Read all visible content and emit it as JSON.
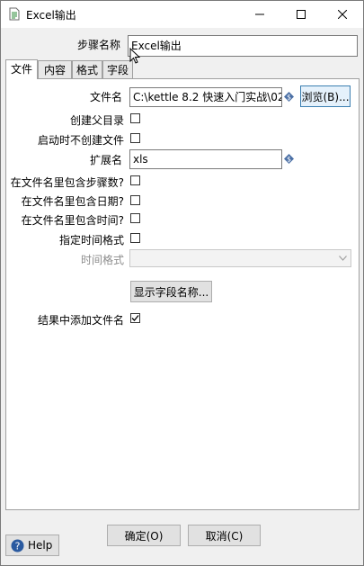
{
  "window": {
    "title": "Excel输出",
    "icon": "document-icon",
    "controls": [
      "minimize-icon",
      "maximize-icon",
      "close-icon"
    ]
  },
  "step_name": {
    "label": "步骤名称",
    "value": "Excel输出"
  },
  "tabs": [
    {
      "label": "文件",
      "active": true
    },
    {
      "label": "内容",
      "active": false
    },
    {
      "label": "格式",
      "active": false
    },
    {
      "label": "字段",
      "active": false
    }
  ],
  "file_tab": {
    "filename_label": "文件名",
    "filename_value": "C:\\kettle 8.2 快速入门实战\\02",
    "browse_label": "浏览(B)...",
    "create_parent_label": "创建父目录",
    "create_parent_checked": false,
    "no_create_on_start_label": "启动时不创建文件",
    "no_create_on_start_checked": false,
    "extension_label": "扩展名",
    "extension_value": "xls",
    "include_stepnr_label": "在文件名里包含步骤数?",
    "include_stepnr_checked": false,
    "include_date_label": "在文件名里包含日期?",
    "include_date_checked": false,
    "include_time_label": "在文件名里包含时间?",
    "include_time_checked": false,
    "specify_format_label": "指定时间格式",
    "specify_format_checked": false,
    "date_format_label": "时间格式",
    "date_format_value": "",
    "show_fields_label": "显示字段名称...",
    "add_to_result_label": "结果中添加文件名",
    "add_to_result_checked": true
  },
  "footer": {
    "ok_label": "确定(O)",
    "cancel_label": "取消(C)",
    "help_label": "Help"
  },
  "colors": {
    "variable_icon": "#4a6fa5",
    "dialog_bg": "#f0f0f0",
    "help_icon": "#2a5aa0"
  }
}
